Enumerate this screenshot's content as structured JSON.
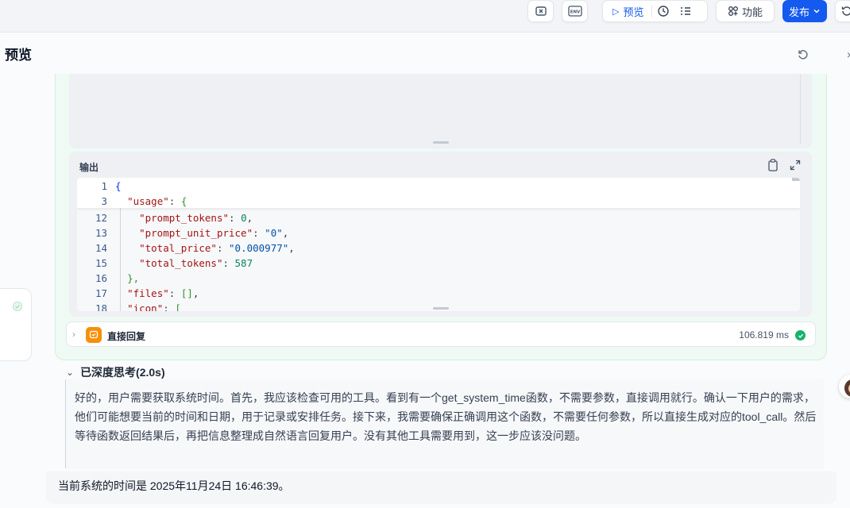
{
  "toolbar": {
    "preview_label": "预览",
    "features_label": "功能",
    "publish_label": "发布",
    "env_label": "ENV"
  },
  "panel": {
    "title": "预览"
  },
  "output": {
    "label": "输出",
    "lines": [
      {
        "num": "1"
      },
      {
        "num": "3"
      },
      {
        "num": "12"
      },
      {
        "num": "13"
      },
      {
        "num": "14"
      },
      {
        "num": "15"
      },
      {
        "num": "16"
      },
      {
        "num": "17"
      },
      {
        "num": "18"
      }
    ],
    "code": {
      "l1": "{",
      "l3_key": "\"usage\"",
      "l3_rest": ": ",
      "l3_brace": "{",
      "l12_key": "\"prompt_tokens\"",
      "l12_val": "0",
      "l13_key": "\"prompt_unit_price\"",
      "l13_val": "\"0\"",
      "l14_key": "\"total_price\"",
      "l14_val": "\"0.000977\"",
      "l15_key": "\"total_tokens\"",
      "l15_val": "587",
      "l16": "},",
      "l17_key": "\"files\"",
      "l17_val": "[]",
      "l18_key": "\"icon\"",
      "l18_val": "["
    }
  },
  "reply_node": {
    "name": "直接回复",
    "duration": "106.819 ms"
  },
  "thinking": {
    "header": "已深度思考(2.0s)",
    "text": "好的，用户需要获取系统时间。首先，我应该检查可用的工具。看到有一个get_system_time函数，不需要参数，直接调用就行。确认一下用户的需求，他们可能想要当前的时间和日期，用于记录或安排任务。接下来，我需要确保正确调用这个函数，不需要任何参数，所以直接生成对应的tool_call。然后等待函数返回结果后，再把信息整理成自然语言回复用户。没有其他工具需要用到，这一步应该没问题。"
  },
  "answer": {
    "text": "当前系统的时间是 2025年11月24日 16:46:39。"
  }
}
